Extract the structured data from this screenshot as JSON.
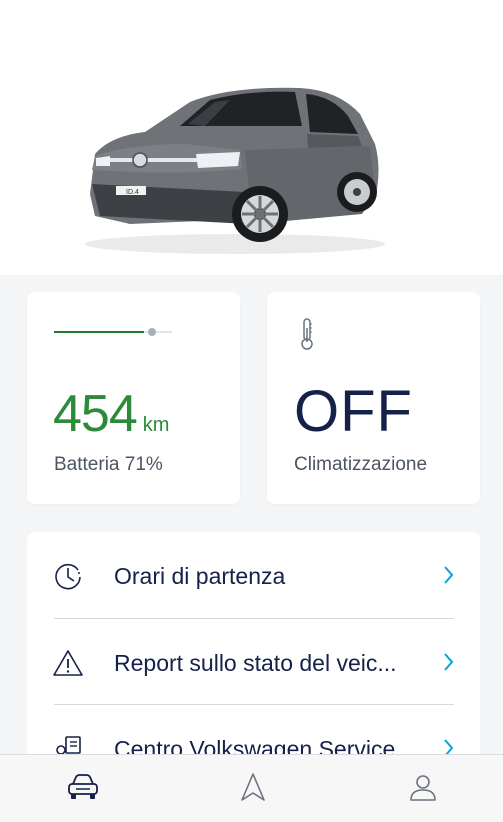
{
  "vehicle": {
    "plate_badge": "ID.4",
    "body_color": "#6f7378"
  },
  "battery": {
    "range_value": "454",
    "range_unit": "km",
    "label": "Batteria 71%",
    "charge_fraction": 0.71,
    "accent_color": "#2d8a3a"
  },
  "climate": {
    "status": "OFF",
    "label": "Climatizzazione",
    "icon": "thermometer-icon"
  },
  "menu": {
    "items": [
      {
        "label": "Orari di partenza",
        "icon": "clock-icon"
      },
      {
        "label": "Report sullo stato del veic...",
        "icon": "warning-icon"
      },
      {
        "label": "Centro Volkswagen Service",
        "icon": "service-icon"
      }
    ],
    "chevron_color": "#00a6d6"
  },
  "tabbar": {
    "tabs": [
      {
        "icon": "car-icon",
        "active": true
      },
      {
        "icon": "navigation-icon",
        "active": false
      },
      {
        "icon": "user-icon",
        "active": false
      }
    ]
  }
}
